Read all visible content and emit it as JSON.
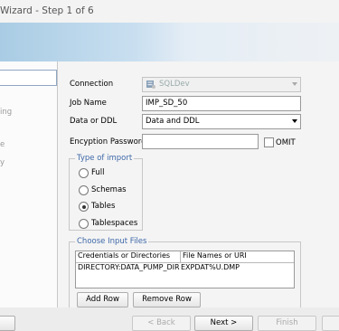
{
  "window": {
    "title": "Wizard - Step 1 of 6"
  },
  "steps": [
    "ing",
    "e",
    "y"
  ],
  "form": {
    "connection_label": "Connection",
    "connection_value": "SQLDev",
    "jobname_label": "Job Name",
    "jobname_value": "IMP_SD_50",
    "dataddl_label": "Data or DDL",
    "dataddl_value": "Data and DDL",
    "encpwd_label": "Encyption Password",
    "encpwd_value": "",
    "omit_label": "OMIT"
  },
  "import_type": {
    "legend": "Type of import",
    "options": [
      "Full",
      "Schemas",
      "Tables",
      "Tablespaces"
    ],
    "selected": "Tables"
  },
  "input_files": {
    "legend": "Choose Input Files",
    "columns": [
      "Credentials or Directories",
      "File Names or URI"
    ],
    "rows": [
      [
        "DIRECTORY:DATA_PUMP_DIR",
        "EXPDAT%U.DMP"
      ]
    ],
    "add_row": "Add Row",
    "remove_row": "Remove Row"
  },
  "nav": {
    "back": "< Back",
    "next": "Next >",
    "finish": "Finish"
  }
}
